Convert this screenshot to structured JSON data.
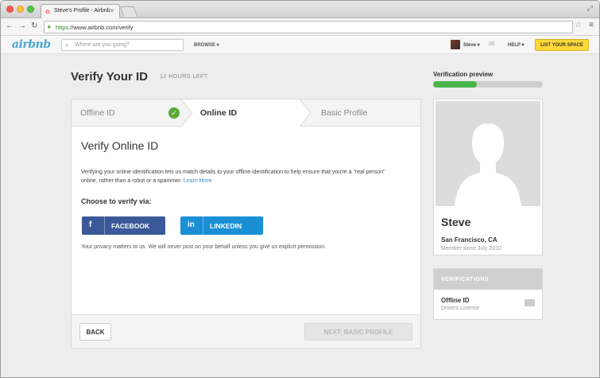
{
  "browser": {
    "tab_title": "Steve's Profile - Airbnb",
    "url_https": "https",
    "url_rest": "://www.airbnb.com/verify"
  },
  "header": {
    "logo": "airbnb",
    "search_placeholder": "Where are you going?",
    "browse": "BROWSE ▾",
    "user": "Steve ▾",
    "help": "HELP ▾",
    "list_space": "LIST YOUR SPACE"
  },
  "main": {
    "title": "Verify Your ID",
    "time_left": "12 HOURS LEFT",
    "steps": [
      {
        "label": "Offline ID",
        "state": "done"
      },
      {
        "label": "Online ID",
        "state": "active"
      },
      {
        "label": "Basic Profile",
        "state": "pending"
      }
    ],
    "section_title": "Verify Online ID",
    "description": "Verifying your online identification lets us match details to your offline identification to help ensure that you're a \"real person\" online, rather than a robot or a spammer.",
    "learn_more": "Learn More",
    "choose_label": "Choose to verify via:",
    "facebook_icon": "f",
    "facebook_label": "FACEBOOK",
    "linkedin_icon": "in",
    "linkedin_label": "LINKEDIN",
    "privacy": "Your privacy matters to us. We will never post on your behalf unless you give us explicit permission.",
    "back_label": "BACK",
    "next_label": "NEXT: BASIC PROFILE"
  },
  "sidebar": {
    "preview_label": "Verification preview",
    "progress": 0.4,
    "name": "Steve",
    "location": "San Francisco, CA",
    "member_since": "Member since July 2010",
    "verifications_header": "VERIFICATIONS",
    "verification_title": "Offline ID",
    "verification_sub": "Drivers License"
  },
  "colors": {
    "facebook": "#3b5998",
    "linkedin": "#1a8fd6",
    "success": "#5aa937",
    "list_button": "#ffd83a",
    "link": "#3b8ed0"
  }
}
